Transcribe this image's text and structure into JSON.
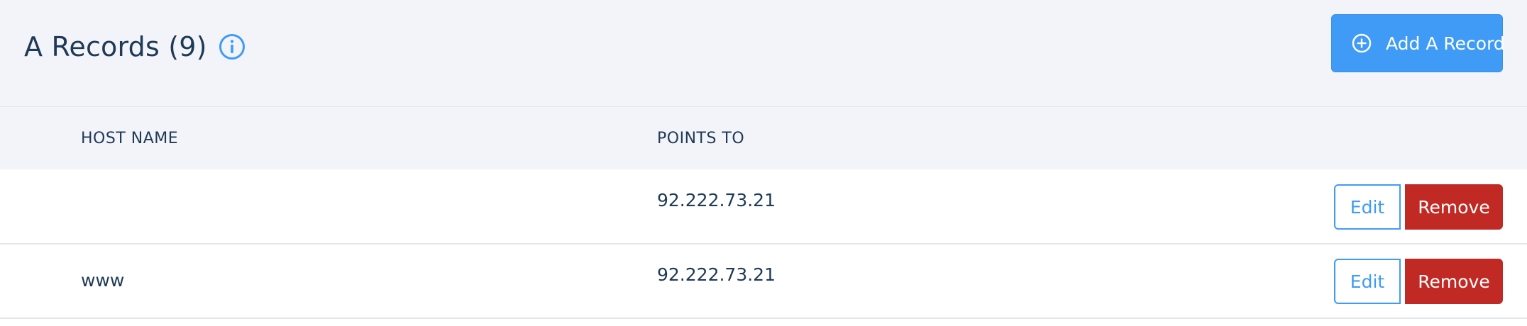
{
  "header": {
    "title": "A Records (9)",
    "info_icon": "info-icon",
    "add_button_label": "Add A Record",
    "add_button_icon": "plus-circle-icon"
  },
  "table": {
    "columns": [
      "HOST NAME",
      "POINTS TO"
    ],
    "rows": [
      {
        "host": "",
        "points_to": "92.222.73.21",
        "edit_label": "Edit",
        "remove_label": "Remove"
      },
      {
        "host": "www",
        "points_to": "92.222.73.21",
        "edit_label": "Edit",
        "remove_label": "Remove"
      }
    ]
  },
  "colors": {
    "primary": "#3f9bf5",
    "danger": "#c12a24",
    "text": "#1f3a55",
    "header_bg": "#f3f4f9"
  }
}
